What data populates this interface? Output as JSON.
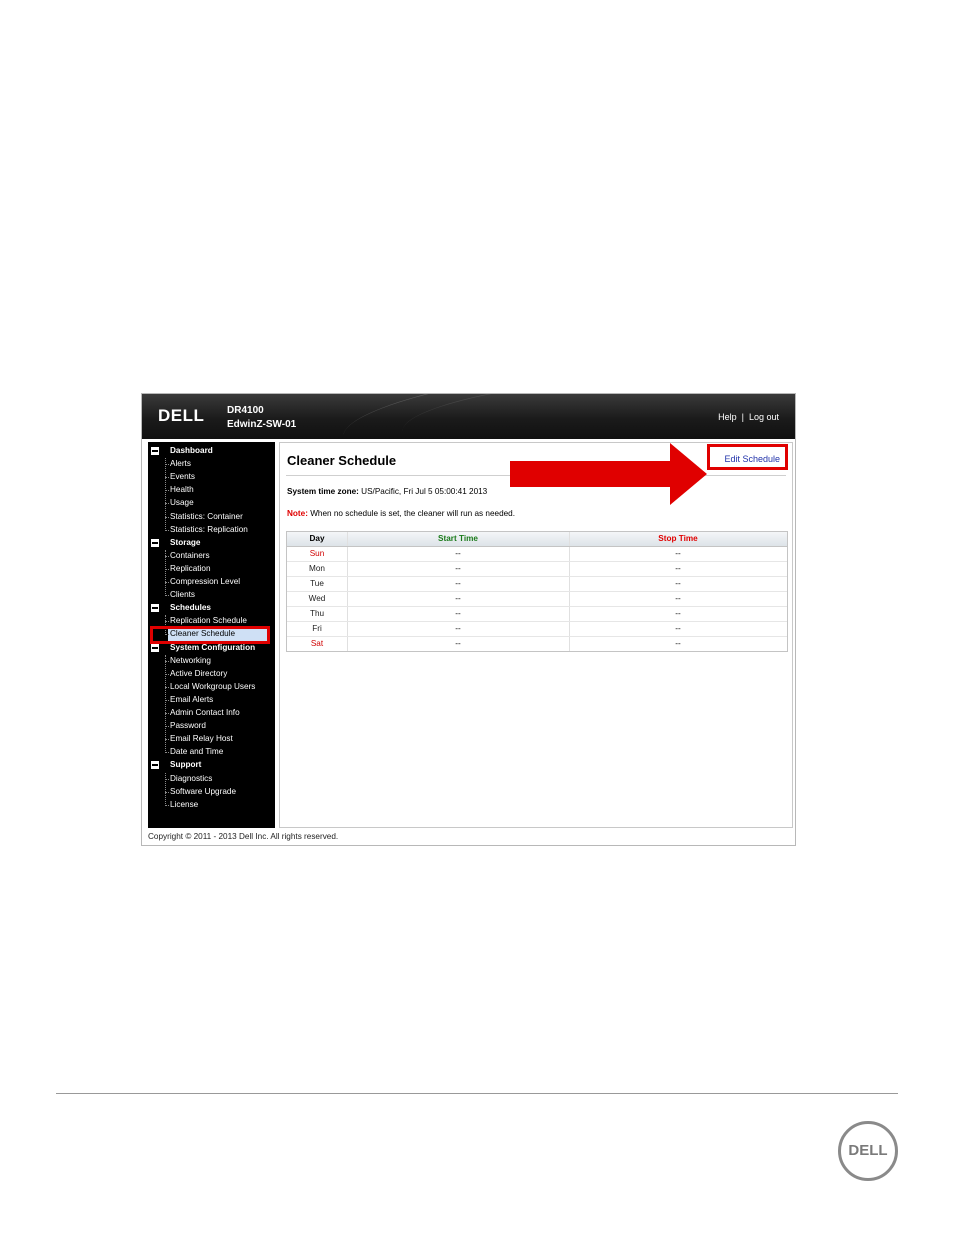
{
  "header": {
    "logo": "DELL",
    "model": "DR4100",
    "system_name": "EdwinZ-SW-01",
    "help_label": "Help",
    "separator": "|",
    "logout_label": "Log out"
  },
  "sidebar": {
    "groups": [
      {
        "label": "Dashboard",
        "items": [
          "Alerts",
          "Events",
          "Health",
          "Usage",
          "Statistics: Container",
          "Statistics: Replication"
        ]
      },
      {
        "label": "Storage",
        "items": [
          "Containers",
          "Replication",
          "Compression Level",
          "Clients"
        ]
      },
      {
        "label": "Schedules",
        "items": [
          "Replication Schedule",
          "Cleaner Schedule"
        ]
      },
      {
        "label": "System Configuration",
        "items": [
          "Networking",
          "Active Directory",
          "Local Workgroup Users",
          "Email Alerts",
          "Admin Contact Info",
          "Password",
          "Email Relay Host",
          "Date and Time"
        ]
      },
      {
        "label": "Support",
        "items": [
          "Diagnostics",
          "Software Upgrade",
          "License"
        ]
      }
    ],
    "selected_item": "Cleaner Schedule"
  },
  "main": {
    "title": "Cleaner Schedule",
    "edit_link": "Edit Schedule",
    "timezone_label": "System time zone:",
    "timezone_value": "US/Pacific, Fri Jul 5 05:00:41 2013",
    "note_label": "Note:",
    "note_text": "When no schedule is set, the cleaner will run as needed.",
    "table": {
      "columns": [
        "Day",
        "Start Time",
        "Stop Time"
      ],
      "header_colors": {
        "day": "#000000",
        "start": "#1a7a1a",
        "stop": "#e00000"
      },
      "rows": [
        {
          "day": "Sun",
          "start": "--",
          "stop": "--",
          "day_color": "#d00000"
        },
        {
          "day": "Mon",
          "start": "--",
          "stop": "--",
          "day_color": "#222222"
        },
        {
          "day": "Tue",
          "start": "--",
          "stop": "--",
          "day_color": "#222222"
        },
        {
          "day": "Wed",
          "start": "--",
          "stop": "--",
          "day_color": "#222222"
        },
        {
          "day": "Thu",
          "start": "--",
          "stop": "--",
          "day_color": "#222222"
        },
        {
          "day": "Fri",
          "start": "--",
          "stop": "--",
          "day_color": "#222222"
        },
        {
          "day": "Sat",
          "start": "--",
          "stop": "--",
          "day_color": "#d00000"
        }
      ]
    }
  },
  "footer": {
    "copyright": "Copyright © 2011 - 2013 Dell Inc. All rights reserved.",
    "page_logo": "DELL"
  },
  "colors": {
    "annotation_red": "#e00000",
    "link_blue": "#2233aa",
    "sidebar_bg": "#000000"
  }
}
